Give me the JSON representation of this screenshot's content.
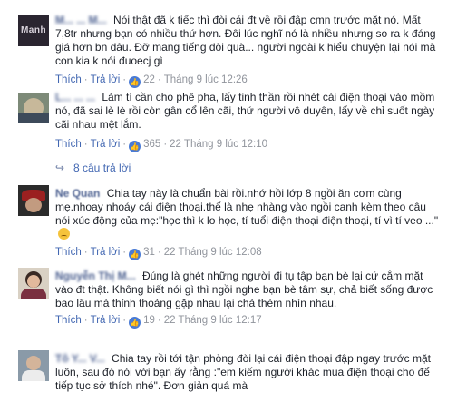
{
  "comments": [
    {
      "author": "M... ... M...",
      "avatar_text": "Manh",
      "text": "Nói thật đã k tiếc thì đòi cái đt về rồi đập cmn trước mặt nó. Mất 7,8tr nhưng bạn có nhiều thứ hơn. Đôi lúc nghĩ nó là nhiều nhưng so ra k đáng giá hơn bn đâu. Đỡ mang tiếng đòi quà... người ngoài k hiểu chuyện lại nói mà con kia k nói đuoecj gì",
      "like": "Thích",
      "reply": "Trả lời",
      "reactions": "22",
      "time": "Tháng 9 lúc 12:26"
    },
    {
      "author": "L... ... ...",
      "text": "Làm tí cần cho phê pha, lấy tinh thần rồi nhét cái điện thoại vào mồm nó, đã sai lè lè rồi còn gân cổ lên cãi, thứ người vô duyên, lấy về chỉ suốt ngày cãi nhau mệt lắm.",
      "like": "Thích",
      "reply": "Trả lời",
      "reactions": "365",
      "time": "22 Tháng 9 lúc 12:10",
      "replies_label": "8 câu trả lời"
    },
    {
      "author": "Ne Quan",
      "text": "Chia tay này là chuẩn bài rồi.nhớ hồi lớp 8 ngồi ăn cơm cùng mẹ.nhoay nhoáy cái điện thoại.thế là nhẹ nhàng vào ngồi canh kèm theo câu nói xúc động của mẹ:\"học thì k lo học, tí tuổi điện thoại điện thoại, tí vì tí veo ...\"",
      "like": "Thích",
      "reply": "Trả lời",
      "reactions": "31",
      "time": "22 Tháng 9 lúc 12:08"
    },
    {
      "author": "Nguyễn Thị M...",
      "text": "Đúng là ghét những người đi tụ tập bạn bè lại cứ cắm mặt vào đt thật. Không biết nói gì thì ngồi nghe bạn bè tâm sự, chả biết sống được bao lâu mà thỉnh thoảng gặp nhau lại chả thèm nhìn nhau.",
      "like": "Thích",
      "reply": "Trả lời",
      "reactions": "19",
      "time": "22 Tháng 9 lúc 12:17"
    },
    {
      "author": "Tô Y... V...",
      "text": "Chia tay rồi tới tận phòng đòi lại cái điện thoại đập ngay trước mặt luôn, sau đó nói với bạn ấy rằng :\"em kiếm người khác mua điện thoại cho để tiếp tục sở thích nhé\". Đơn giản quá mà"
    }
  ],
  "colors": {
    "link": "#365899",
    "meta_link": "#4267b2",
    "meta_gray": "#90949c",
    "like_badge": "#4a7bd5"
  }
}
